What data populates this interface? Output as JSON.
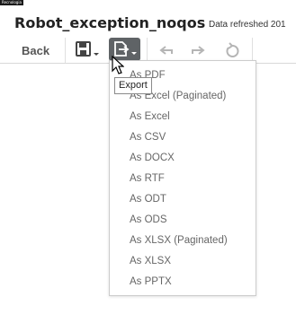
{
  "corner_label": "Recnologia",
  "report": {
    "title": "Robot_exception_noqos",
    "refreshed_text": "Data refreshed 201"
  },
  "toolbar": {
    "back_label": "Back",
    "tooltip": "Export"
  },
  "export_menu": {
    "items": [
      "As PDF",
      "As Excel (Paginated)",
      "As Excel",
      "As CSV",
      "As DOCX",
      "As RTF",
      "As ODT",
      "As ODS",
      "As XLSX (Paginated)",
      "As XLSX",
      "As PPTX"
    ]
  },
  "colors": {
    "export_button_bg": "#5f6366",
    "menu_text": "#666666",
    "disabled_icon": "#b5b5b5"
  }
}
